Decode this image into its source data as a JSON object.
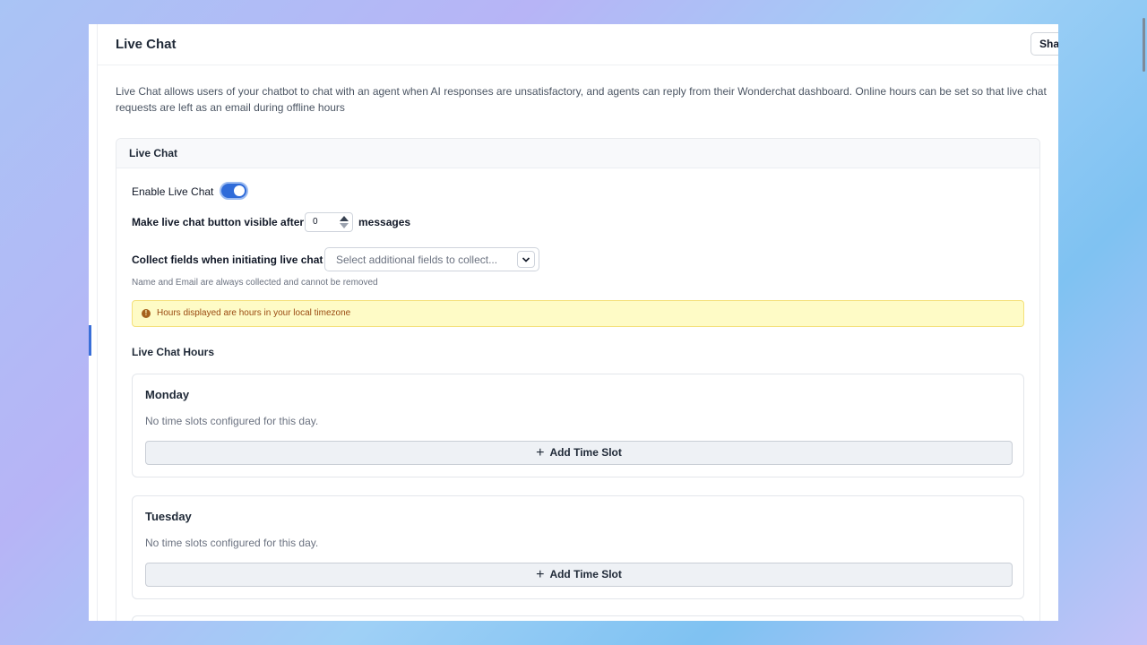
{
  "header": {
    "title": "Live Chat",
    "share_label": "Share"
  },
  "description": "Live Chat allows users of your chatbot to chat with an agent when AI responses are unsatisfactory, and agents can reply from their Wonderchat dashboard. Online hours can be set so that live chat requests are left as an email during offline hours",
  "panel": {
    "title": "Live Chat",
    "enable_label": "Enable Live Chat",
    "enable_on": true,
    "visible_after_label": "Make live chat button visible after",
    "visible_after_value": "0",
    "visible_after_suffix": "messages",
    "collect_label": "Collect fields when initiating live chat",
    "collect_placeholder": "Select additional fields to collect...",
    "collect_hint": "Name and Email are always collected and cannot be removed",
    "alert_text": "Hours displayed are hours in your local timezone",
    "hours_title": "Live Chat Hours",
    "days": [
      {
        "name": "Monday",
        "empty_text": "No time slots configured for this day.",
        "add_label": "Add Time Slot"
      },
      {
        "name": "Tuesday",
        "empty_text": "No time slots configured for this day.",
        "add_label": "Add Time Slot"
      }
    ]
  },
  "colors": {
    "accent": "#2f6bd9",
    "alert_bg": "#fefbc6",
    "alert_text": "#9a4b12"
  },
  "icons": {
    "toggle": "toggle-switch",
    "stepper": "up-down-arrows",
    "select": "chevron-down-icon",
    "alert": "info-icon",
    "add": "plus-icon"
  }
}
